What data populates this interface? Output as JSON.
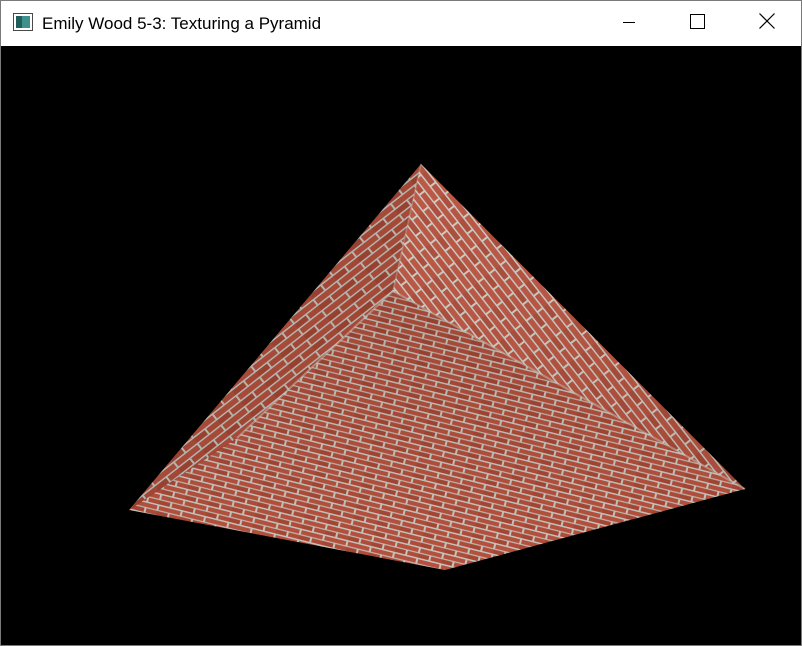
{
  "window": {
    "title": "Emily Wood 5-3: Texturing a Pyramid",
    "app_icon": "opengl-window-icon",
    "controls": {
      "minimize_icon": "minimize-icon",
      "maximize_icon": "maximize-icon",
      "close_icon": "close-icon"
    }
  },
  "viewport": {
    "background_color": "#000000",
    "object": "textured-pyramid",
    "texture": "brick-wall",
    "colors": {
      "brick": "#b9523f",
      "brick_dark": "#8f3a2b",
      "mortar": "#c9c8bf"
    }
  }
}
